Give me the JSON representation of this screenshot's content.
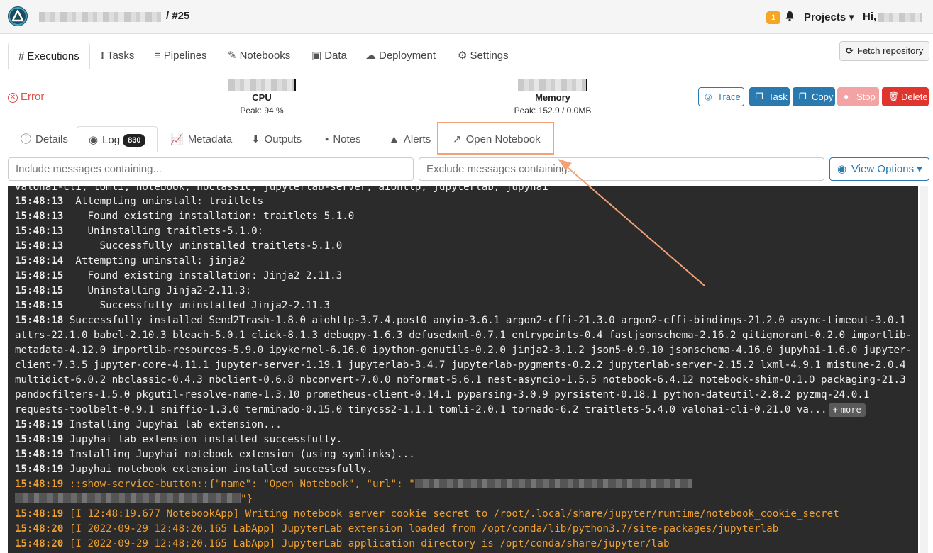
{
  "header": {
    "breadcrumb_suffix": "/ #25",
    "notifications_count": "1",
    "projects_label": "Projects ▾",
    "greeting": "Hi,"
  },
  "main_tabs": [
    {
      "icon": "#",
      "icon_name": "hash-icon",
      "label": "Executions",
      "active": true
    },
    {
      "icon": "!",
      "icon_name": "exclamation-icon",
      "label": "Tasks"
    },
    {
      "icon": "≡",
      "icon_name": "bars-icon",
      "label": "Pipelines"
    },
    {
      "icon": "✎",
      "icon_name": "pencil-icon",
      "label": "Notebooks"
    },
    {
      "icon": "▣",
      "icon_name": "floppy-icon",
      "label": "Data"
    },
    {
      "icon": "☁",
      "icon_name": "cloud-icon",
      "label": "Deployment"
    },
    {
      "icon": "⚙",
      "icon_name": "gear-icon",
      "label": "Settings"
    }
  ],
  "fetch_repository": "Fetch repository",
  "status": {
    "label": "Error"
  },
  "cpu": {
    "name": "CPU",
    "peak": "Peak: 94 %"
  },
  "memory": {
    "name": "Memory",
    "peak": "Peak: 152.9 / 0.0MB"
  },
  "actions": {
    "trace": "Trace",
    "task": "Task",
    "copy": "Copy",
    "stop": "Stop",
    "delete": "Delete"
  },
  "sub_tabs": {
    "details": "Details",
    "log": "Log",
    "log_count": "830",
    "metadata": "Metadata",
    "outputs": "Outputs",
    "notes": "Notes",
    "alerts": "Alerts",
    "open_notebook": "Open Notebook"
  },
  "filters": {
    "include_placeholder": "Include messages containing...",
    "exclude_placeholder": "Exclude messages containing..."
  },
  "view_options": "View Options ▾",
  "more_label": "more",
  "log_lines": [
    {
      "time": "",
      "text": "valohai-cli, tomli, notebook, nbclassic, jupyterlab-server, aiohttp, jupyterlab, jupyhai"
    },
    {
      "time": "15:48:13",
      "text": "  Attempting uninstall: traitlets"
    },
    {
      "time": "15:48:13",
      "text": "    Found existing installation: traitlets 5.1.0"
    },
    {
      "time": "15:48:13",
      "text": "    Uninstalling traitlets-5.1.0:"
    },
    {
      "time": "15:48:13",
      "text": "      Successfully uninstalled traitlets-5.1.0"
    },
    {
      "time": "15:48:14",
      "text": "  Attempting uninstall: jinja2"
    },
    {
      "time": "15:48:15",
      "text": "    Found existing installation: Jinja2 2.11.3"
    },
    {
      "time": "15:48:15",
      "text": "    Uninstalling Jinja2-2.11.3:"
    },
    {
      "time": "15:48:15",
      "text": "      Successfully uninstalled Jinja2-2.11.3"
    },
    {
      "time": "15:48:18",
      "text": "Successfully installed Send2Trash-1.8.0 aiohttp-3.7.4.post0 anyio-3.6.1 argon2-cffi-21.3.0 argon2-cffi-bindings-21.2.0 async-timeout-3.0.1"
    },
    {
      "time": "",
      "text": "attrs-22.1.0 babel-2.10.3 bleach-5.0.1 click-8.1.3 debugpy-1.6.3 defusedxml-0.7.1 entrypoints-0.4 fastjsonschema-2.16.2 gitignorant-0.2.0 importlib-"
    },
    {
      "time": "",
      "text": "metadata-4.12.0 importlib-resources-5.9.0 ipykernel-6.16.0 ipython-genutils-0.2.0 jinja2-3.1.2 json5-0.9.10 jsonschema-4.16.0 jupyhai-1.6.0 jupyter-"
    },
    {
      "time": "",
      "text": "client-7.3.5 jupyter-core-4.11.1 jupyter-server-1.19.1 jupyterlab-3.4.7 jupyterlab-pygments-0.2.2 jupyterlab-server-2.15.2 lxml-4.9.1 mistune-2.0.4"
    },
    {
      "time": "",
      "text": "multidict-6.0.2 nbclassic-0.4.3 nbclient-0.6.8 nbconvert-7.0.0 nbformat-5.6.1 nest-asyncio-1.5.5 notebook-6.4.12 notebook-shim-0.1.0 packaging-21.3"
    },
    {
      "time": "",
      "text": "pandocfilters-1.5.0 pkgutil-resolve-name-1.3.10 prometheus-client-0.14.1 pyparsing-3.0.9 pyrsistent-0.18.1 python-dateutil-2.8.2 pyzmq-24.0.1"
    },
    {
      "time": "",
      "text": "requests-toolbelt-0.9.1 sniffio-1.3.0 terminado-0.15.0 tinycss2-1.1.1 tomli-2.0.1 tornado-6.2 traitlets-5.4.0 valohai-cli-0.21.0 va..."
    },
    {
      "time": "15:48:19",
      "text": "Installing Jupyhai lab extension..."
    },
    {
      "time": "15:48:19",
      "text": "Jupyhai lab extension installed successfully."
    },
    {
      "time": "15:48:19",
      "text": "Installing Jupyhai notebook extension (using symlinks)..."
    },
    {
      "time": "15:48:19",
      "text": "Jupyhai notebook extension installed successfully."
    },
    {
      "time": "15:48:19",
      "text": "::show-service-button::{\"name\": \"Open Notebook\", \"url\": \""
    },
    {
      "time": "",
      "text": "\"}"
    },
    {
      "time": "15:48:19",
      "text": "[I 12:48:19.677 NotebookApp] Writing notebook server cookie secret to /root/.local/share/jupyter/runtime/notebook_cookie_secret"
    },
    {
      "time": "15:48:20",
      "text": "[I 2022-09-29 12:48:20.165 LabApp] JupyterLab extension loaded from /opt/conda/lib/python3.7/site-packages/jupyterlab"
    },
    {
      "time": "15:48:20",
      "text": "[I 2022-09-29 12:48:20.165 LabApp] JupyterLab application directory is /opt/conda/share/jupyter/lab"
    }
  ],
  "colors": {
    "primary": "#2a7ab0",
    "danger": "#e0352e",
    "log_bg": "#2b2b2b",
    "log_warn": "#f0a030",
    "highlight": "#f4a178"
  }
}
